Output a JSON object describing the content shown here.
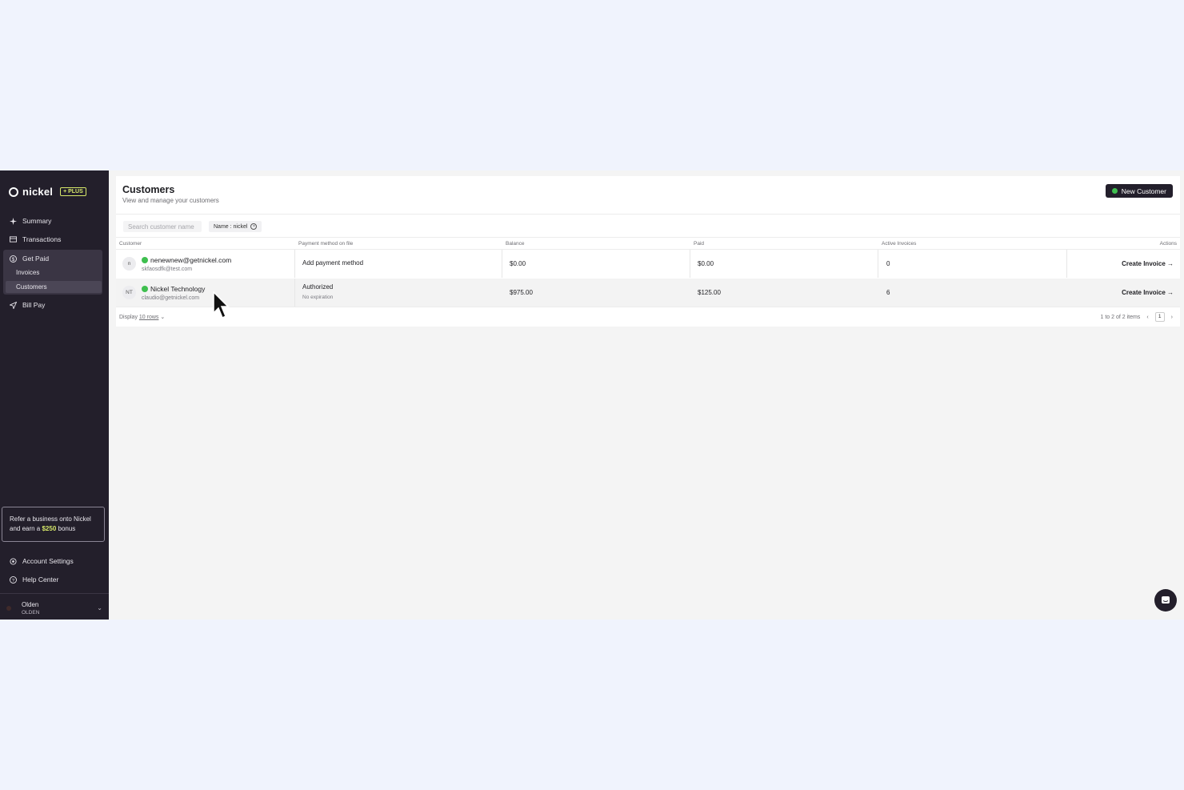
{
  "brand": {
    "name": "nickel",
    "badge": "+ PLUS"
  },
  "sidebar": {
    "items": [
      {
        "label": "Summary",
        "icon": "sparkle-icon"
      },
      {
        "label": "Transactions",
        "icon": "card-icon"
      },
      {
        "label": "Get Paid",
        "icon": "dollar-circle-icon"
      },
      {
        "label": "Bill Pay",
        "icon": "send-icon"
      }
    ],
    "sub_items": [
      {
        "label": "Invoices"
      },
      {
        "label": "Customers"
      }
    ],
    "promo": {
      "text_before": "Refer a business onto Nickel and earn a ",
      "amount": "$250",
      "text_after": " bonus"
    },
    "bottom_items": [
      {
        "label": "Account Settings",
        "icon": "gear-icon"
      },
      {
        "label": "Help Center",
        "icon": "help-circle-icon"
      }
    ],
    "user": {
      "name": "Olden",
      "org": "OLDEN"
    }
  },
  "page": {
    "title": "Customers",
    "subtitle": "View and manage your customers",
    "new_button": "New Customer",
    "search_placeholder": "Search customer name",
    "filter_chip": "Name : nickel"
  },
  "table": {
    "headers": [
      "Customer",
      "Payment method on file",
      "Balance",
      "Paid",
      "Active Invoices",
      "Actions"
    ],
    "rows": [
      {
        "avatar": "n",
        "name": "nenewnew@getnickel.com",
        "email": "skfaosdfk@test.com",
        "payment": "Add payment method",
        "payment_sub": "",
        "balance": "$0.00",
        "paid": "$0.00",
        "active": "0",
        "action": "Create Invoice →"
      },
      {
        "avatar": "NT",
        "name": "Nickel Technology",
        "email": "claudio@getnickel.com",
        "payment": "Authorized",
        "payment_sub": "No expiration",
        "balance": "$975.00",
        "paid": "$125.00",
        "active": "6",
        "action": "Create Invoice →"
      }
    ]
  },
  "footer": {
    "display_label": "Display",
    "rows_label": "10 rows",
    "range": "1 to 2 of 2 items",
    "page": "1"
  },
  "colors": {
    "sidebar_bg": "#231f2b",
    "accent_green": "#3fbf4f",
    "plus_yellow": "#d6e86a"
  }
}
